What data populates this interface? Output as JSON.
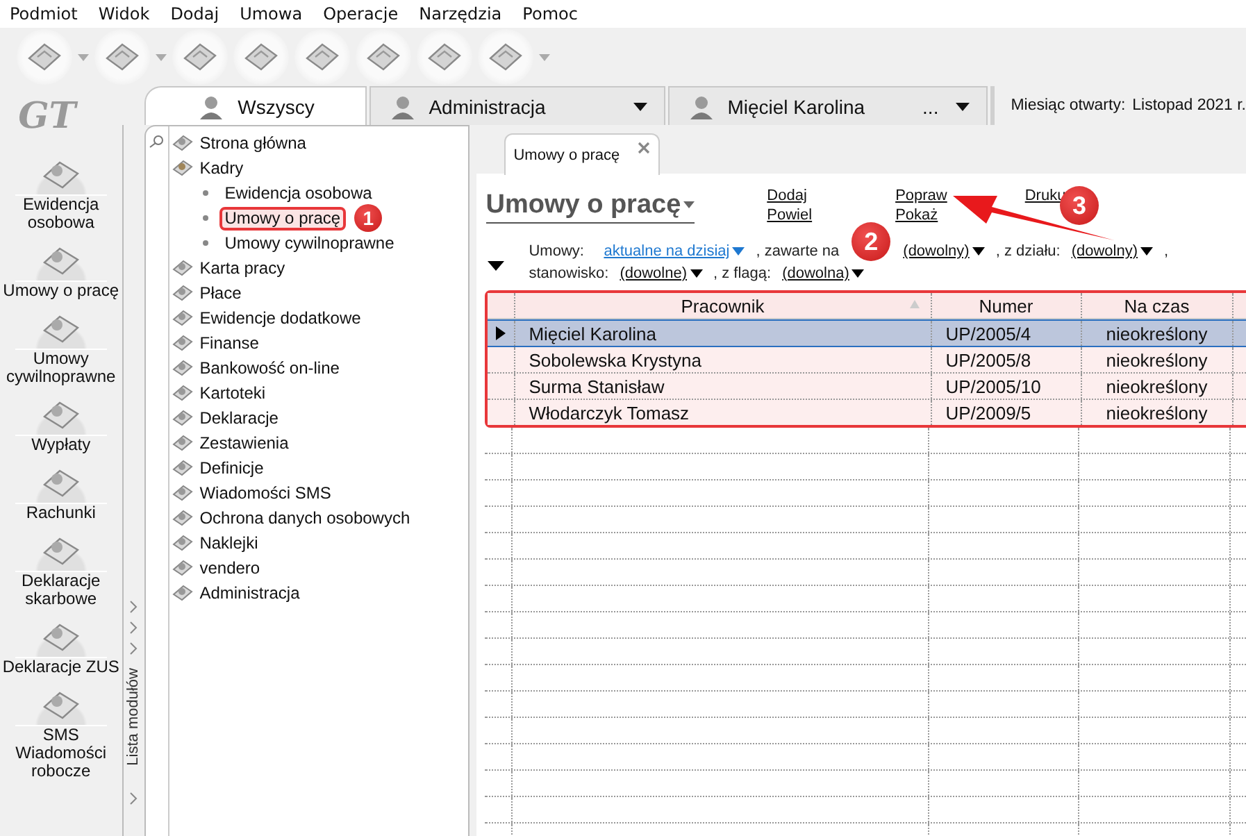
{
  "menu": [
    "Podmiot",
    "Widok",
    "Dodaj",
    "Umowa",
    "Operacje",
    "Narzędzia",
    "Pomoc"
  ],
  "logo": "GT",
  "header_tabs": [
    {
      "label": "Wszyscy",
      "selected": true,
      "dropdown": false
    },
    {
      "label": "Administracja",
      "selected": false,
      "dropdown": true
    },
    {
      "label": "Mięciel Karolina",
      "extra": "...",
      "selected": false,
      "dropdown": true
    }
  ],
  "month": {
    "label": "Miesiąc otwarty:",
    "value": "Listopad 2021 r."
  },
  "nav_items": [
    {
      "lines": [
        "Ewidencja",
        "osobowa"
      ]
    },
    {
      "lines": [
        "Umowy o pracę"
      ]
    },
    {
      "lines": [
        "Umowy",
        "cywilnoprawne"
      ]
    },
    {
      "lines": [
        "Wypłaty"
      ]
    },
    {
      "lines": [
        "Rachunki"
      ]
    },
    {
      "lines": [
        "Deklaracje",
        "skarbowe"
      ]
    },
    {
      "lines": [
        "Deklaracje ZUS"
      ]
    },
    {
      "lines": [
        "SMS",
        "Wiadomości",
        "robocze"
      ]
    }
  ],
  "module_strip": "Lista modułów",
  "tree": [
    {
      "label": "Strona główna"
    },
    {
      "label": "Kadry",
      "expanded": true,
      "children": [
        {
          "label": "Ewidencja osobowa",
          "selected": false
        },
        {
          "label": "Umowy o pracę",
          "selected": true
        },
        {
          "label": "Umowy cywilnoprawne",
          "selected": false
        }
      ]
    },
    {
      "label": "Karta pracy"
    },
    {
      "label": "Płace"
    },
    {
      "label": "Ewidencje dodatkowe"
    },
    {
      "label": "Finanse"
    },
    {
      "label": "Bankowość on-line"
    },
    {
      "label": "Kartoteki"
    },
    {
      "label": "Deklaracje"
    },
    {
      "label": "Zestawienia"
    },
    {
      "label": "Definicje"
    },
    {
      "label": "Wiadomości SMS"
    },
    {
      "label": "Ochrona danych osobowych"
    },
    {
      "label": "Naklejki"
    },
    {
      "label": "vendero"
    },
    {
      "label": "Administracja"
    }
  ],
  "document_tab": {
    "label": "Umowy o pracę",
    "closable": true
  },
  "title": "Umowy o pracę",
  "actions": [
    [
      {
        "label": "Dodaj"
      },
      {
        "label": "Powiel"
      }
    ],
    [
      {
        "label": "Popraw"
      },
      {
        "label": "Pokaż"
      }
    ],
    [
      {
        "label": "Druku"
      }
    ]
  ],
  "filters": [
    [
      {
        "kind": "label",
        "text": "Umowy:"
      },
      {
        "kind": "link",
        "text": "aktualne na dzisiaj"
      },
      {
        "kind": "label",
        "text": ", zawarte na"
      },
      {
        "kind": "dropdown",
        "text": "(dowolny)"
      },
      {
        "kind": "label",
        "text": ", z działu:"
      },
      {
        "kind": "dropdown",
        "text": "(dowolny)"
      },
      {
        "kind": "label",
        "text": ","
      }
    ],
    [
      {
        "kind": "label",
        "text": "stanowisko:"
      },
      {
        "kind": "dropdown",
        "text": "(dowolne)"
      },
      {
        "kind": "label",
        "text": ", z flagą:"
      },
      {
        "kind": "dropdown",
        "text": "(dowolna)"
      }
    ]
  ],
  "table": {
    "columns": [
      "Pracownik",
      "Numer",
      "Na czas"
    ],
    "rows": [
      {
        "cells": [
          "Mięciel Karolina",
          "UP/2005/4",
          "nieokreślony"
        ],
        "selected": true
      },
      {
        "cells": [
          "Sobolewska Krystyna",
          "UP/2005/8",
          "nieokreślony"
        ],
        "selected": false
      },
      {
        "cells": [
          "Surma Stanisław",
          "UP/2005/10",
          "nieokreślony"
        ],
        "selected": false
      },
      {
        "cells": [
          "Włodarczyk Tomasz",
          "UP/2009/5",
          "nieokreślony"
        ],
        "selected": false
      }
    ]
  },
  "annotations": [
    "1",
    "2",
    "3"
  ]
}
